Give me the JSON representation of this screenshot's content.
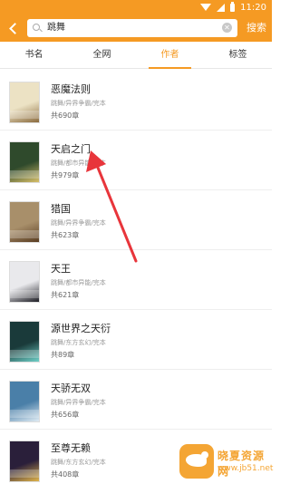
{
  "status_bar": {
    "time": "11:20"
  },
  "toolbar": {
    "search_value": "跳舞",
    "search_button": "搜索"
  },
  "tabs": [
    {
      "label": "书名",
      "active": false
    },
    {
      "label": "全网",
      "active": false
    },
    {
      "label": "作者",
      "active": true
    },
    {
      "label": "标签",
      "active": false
    }
  ],
  "books": [
    {
      "title": "恶魔法则",
      "meta": "跳舞/异界争霸/完本",
      "chapters": "共690章",
      "cover_color": "#ece2c4",
      "cover_accent": "#8b6b3e"
    },
    {
      "title": "天启之门",
      "meta": "跳舞/都市异能/完本",
      "chapters": "共979章",
      "cover_color": "#2f4a2c",
      "cover_accent": "#d8c06a"
    },
    {
      "title": "猎国",
      "meta": "跳舞/异界争霸/完本",
      "chapters": "共623章",
      "cover_color": "#a88f6a",
      "cover_accent": "#5a3d22"
    },
    {
      "title": "天王",
      "meta": "跳舞/都市异能/完本",
      "chapters": "共621章",
      "cover_color": "#e9e9ec",
      "cover_accent": "#1d1d24"
    },
    {
      "title": "源世界之天衍",
      "meta": "跳舞/东方玄幻/完本",
      "chapters": "共89章",
      "cover_color": "#1a3a3a",
      "cover_accent": "#6fd0c8"
    },
    {
      "title": "天骄无双",
      "meta": "跳舞/异界争霸/完本",
      "chapters": "共656章",
      "cover_color": "#4a7fa8",
      "cover_accent": "#e0ecf4"
    },
    {
      "title": "至尊无赖",
      "meta": "跳舞/东方玄幻/完本",
      "chapters": "共408章",
      "cover_color": "#2a1f3a",
      "cover_accent": "#e0b44a"
    }
  ],
  "watermark": {
    "name": "晓夏资源网",
    "url": "www.jb51.net"
  },
  "colors": {
    "accent": "#f59a23",
    "annotation_arrow": "#e8353b"
  }
}
